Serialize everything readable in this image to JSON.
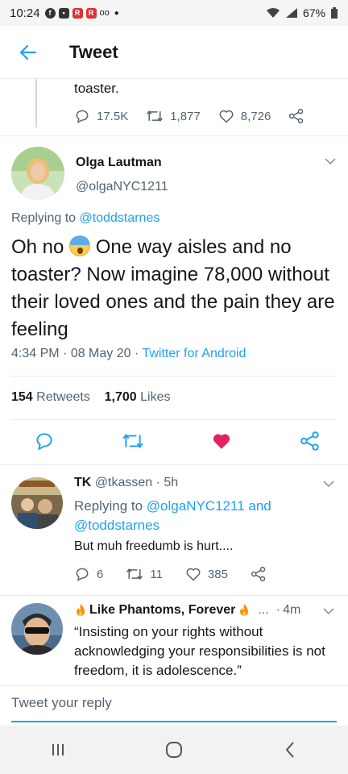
{
  "status_bar": {
    "time": "10:24",
    "battery": "67%"
  },
  "header": {
    "title": "Tweet"
  },
  "previous_tweet": {
    "text_tail": "toaster.",
    "replies": "17.5K",
    "retweets": "1,877",
    "likes": "8,726"
  },
  "main_tweet": {
    "name": "Olga Lautman",
    "handle": "@olgaNYC1211",
    "replying_prefix": "Replying to",
    "replying_to": "@toddstarnes",
    "text_before_emoji": "Oh no",
    "text_after_emoji": "One way aisles and no toaster? Now imagine 78,000 without their loved ones and the pain they are feeling",
    "time": "4:34 PM",
    "date": "08 May 20",
    "client": "Twitter for Android",
    "retweet_count": "154",
    "retweet_label": "Retweets",
    "like_count": "1,700",
    "like_label": "Likes"
  },
  "replies": [
    {
      "name": "TK",
      "handle": "@tkassen",
      "time": "5h",
      "replying_prefix": "Replying to",
      "replying_to_1": "@olgaNYC1211",
      "and": "and",
      "replying_to_2": "@toddstarnes",
      "text": "But muh freedumb is hurt....",
      "reply_count": "6",
      "retweet_count": "11",
      "like_count": "385"
    },
    {
      "name": "Like Phantoms, Forever",
      "ellipsis": "...",
      "time": "4m",
      "text": "“Insisting on your rights without acknowledging your responsibilities is not freedom, it is adolescence.”"
    }
  ],
  "reply_box": {
    "placeholder": "Tweet your reply"
  },
  "colors": {
    "accent": "#1da1f2",
    "like": "#e0245e",
    "text": "#14171a",
    "secondary": "#536471"
  }
}
